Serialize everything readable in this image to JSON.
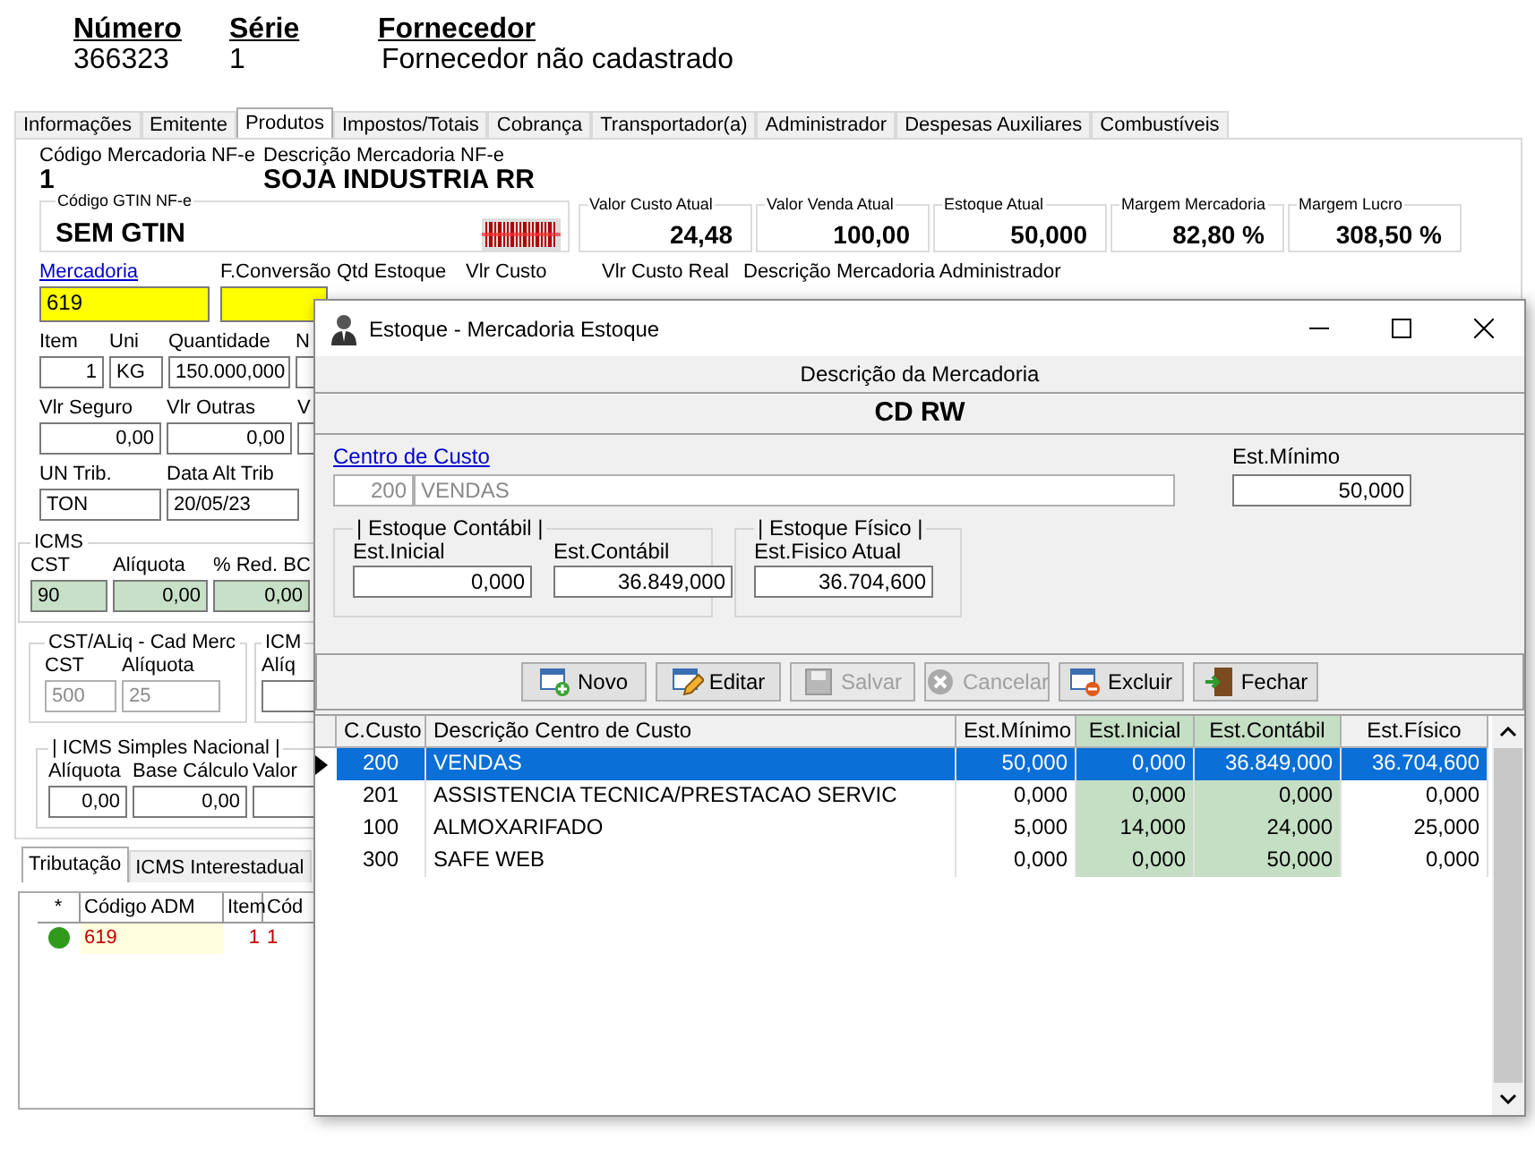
{
  "header": [
    {
      "label": "Número",
      "value": "366323"
    },
    {
      "label": "Série",
      "value": "1"
    },
    {
      "label": "Fornecedor",
      "value": "Fornecedor não cadastrado"
    }
  ],
  "tabs": [
    {
      "label": "Informações",
      "selected": false
    },
    {
      "label": "Emitente",
      "selected": false
    },
    {
      "label": "Produtos",
      "selected": true
    },
    {
      "label": "Impostos/Totais",
      "selected": false
    },
    {
      "label": "Cobrança",
      "selected": false
    },
    {
      "label": "Transportador(a)",
      "selected": false
    },
    {
      "label": "Administrador",
      "selected": false
    },
    {
      "label": "Despesas Auxiliares",
      "selected": false
    },
    {
      "label": "Combustíveis",
      "selected": false
    }
  ],
  "product": {
    "code_label": "Código Mercadoria NF-e",
    "code": "1",
    "desc_label": "Descrição Mercadoria NF-e",
    "desc": "SOJA INDUSTRIA RR"
  },
  "gtin": {
    "label": "Código GTIN NF-e",
    "value": "SEM GTIN"
  },
  "summary": [
    {
      "label": "Valor Custo Atual",
      "value": "24,48"
    },
    {
      "label": "Valor Venda Atual",
      "value": "100,00"
    },
    {
      "label": "Estoque Atual",
      "value": "50,000"
    },
    {
      "label": "Margem Mercadoria",
      "value": "82,80 %"
    },
    {
      "label": "Margem Lucro",
      "value": "308,50 %"
    }
  ],
  "mercadoria_labels": [
    {
      "label": "Mercadoria",
      "kind": "link"
    },
    {
      "label": "F.Conversão",
      "kind": "text"
    },
    {
      "label": "Qtd Estoque",
      "kind": "text"
    },
    {
      "label": "Vlr Custo",
      "kind": "text"
    },
    {
      "label": "Vlr Custo Real",
      "kind": "text"
    },
    {
      "label": "Descrição Mercadoria Administrador",
      "kind": "text"
    }
  ],
  "mercadoria_value": "619",
  "item_rows": [
    [
      {
        "label": "Item",
        "value": "1"
      },
      {
        "label": "Uni",
        "value": "KG"
      },
      {
        "label": "Quantidade",
        "value": "150.000,000"
      },
      {
        "label": "N"
      }
    ],
    [
      {
        "label": "Vlr Seguro",
        "value": "0,00"
      },
      {
        "label": "Vlr Outras",
        "value": "0,00"
      },
      {
        "label": "V"
      }
    ],
    [
      {
        "label": "UN Trib.",
        "value": "TON"
      },
      {
        "label": "Data Alt Trib",
        "value": "20/05/23"
      }
    ]
  ],
  "icms": {
    "title": "ICMS",
    "fields": [
      {
        "label": "CST",
        "value": "90"
      },
      {
        "label": "Alíquota",
        "value": "0,00"
      },
      {
        "label": "% Red. BC",
        "value": "0,00"
      }
    ]
  },
  "cad_merc": {
    "title": "CST/ALiq - Cad Merc",
    "fields": [
      {
        "label": "CST",
        "value": "500",
        "disabled": true
      },
      {
        "label": "Alíquota",
        "value": "25",
        "disabled": true
      }
    ]
  },
  "icm_group": {
    "title": "ICM",
    "field_label": "Alíq"
  },
  "simples": {
    "title": "| ICMS Simples Nacional |",
    "fields": [
      {
        "label": "Alíquota",
        "value": "0,00"
      },
      {
        "label": "Base Cálculo",
        "value": "0,00"
      },
      {
        "label": "Valor"
      }
    ]
  },
  "bottom_tabs": [
    {
      "label": "Tributação",
      "selected": true
    },
    {
      "label": "ICMS Interestadual",
      "selected": false
    }
  ],
  "bottom_grid": {
    "status_header": "*",
    "columns": [
      "Código ADM",
      "Item",
      "Cód"
    ],
    "rows": [
      {
        "color": "#2f9a1c",
        "cells": [
          "619",
          "1",
          "1"
        ]
      }
    ]
  },
  "dialog": {
    "title": "Estoque - Mercadoria Estoque",
    "desc_label": "Descrição da Mercadoria",
    "desc": "CD RW",
    "centro_label": "Centro de Custo",
    "centro_code": "200",
    "centro_name": "VENDAS",
    "min_label": "Est.Mínimo",
    "min_value": "50,000",
    "contabil": {
      "title": "| Estoque Contábil |",
      "fields": [
        {
          "label": "Est.Inicial",
          "value": "0,000"
        },
        {
          "label": "Est.Contábil",
          "value": "36.849,000"
        }
      ]
    },
    "fisico": {
      "title": "| Estoque Físico |",
      "fields": [
        {
          "label": "Est.Fisico Atual",
          "value": "36.704,600"
        }
      ]
    },
    "buttons": [
      {
        "label": "Novo",
        "disabled": false
      },
      {
        "label": "Editar",
        "disabled": false
      },
      {
        "label": "Salvar",
        "disabled": true
      },
      {
        "label": "Cancelar",
        "disabled": true
      },
      {
        "label": "Excluir",
        "disabled": false
      },
      {
        "label": "Fechar",
        "disabled": false
      }
    ],
    "grid": {
      "columns": [
        {
          "label": "C.Custo",
          "shaded": false
        },
        {
          "label": "Descrição Centro de Custo",
          "shaded": false
        },
        {
          "label": "Est.Mínimo",
          "shaded": false
        },
        {
          "label": "Est.Inicial",
          "shaded": true
        },
        {
          "label": "Est.Contábil",
          "shaded": true
        },
        {
          "label": "Est.Físico",
          "shaded": false
        }
      ],
      "rows": [
        {
          "selected": true,
          "cells": [
            "200",
            "VENDAS",
            "50,000",
            "0,000",
            "36.849,000",
            "36.704,600"
          ]
        },
        {
          "selected": false,
          "cells": [
            "201",
            "ASSISTENCIA TECNICA/PRESTACAO SERVIC",
            "0,000",
            "0,000",
            "0,000",
            "0,000"
          ]
        },
        {
          "selected": false,
          "cells": [
            "100",
            "ALMOXARIFADO",
            "5,000",
            "14,000",
            "24,000",
            "25,000"
          ]
        },
        {
          "selected": false,
          "cells": [
            "300",
            "SAFE WEB",
            "0,000",
            "0,000",
            "50,000",
            "0,000"
          ]
        }
      ]
    }
  }
}
